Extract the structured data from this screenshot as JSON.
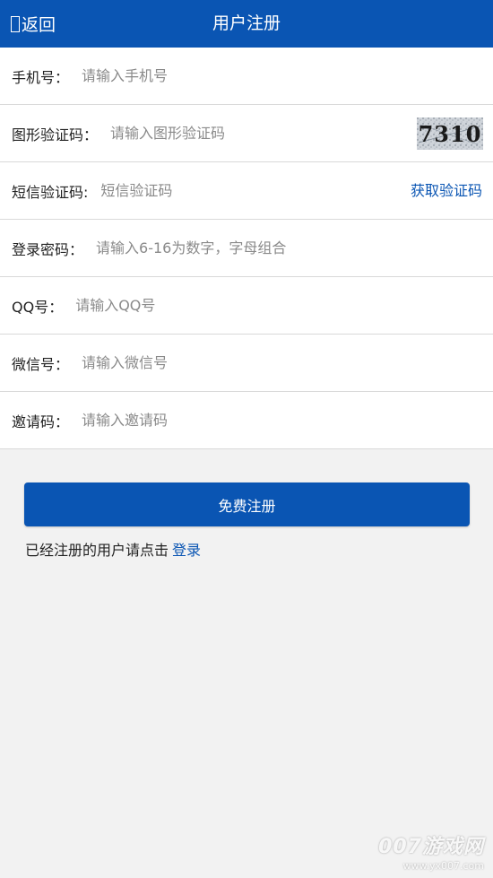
{
  "header": {
    "back_label": "返回",
    "title": "用户注册"
  },
  "form": {
    "phone": {
      "label": "手机号：",
      "placeholder": "请输入手机号"
    },
    "image_code": {
      "label": "图形验证码：",
      "placeholder": "请输入图形验证码",
      "captcha_text": "7310"
    },
    "sms_code": {
      "label": "短信验证码:",
      "placeholder": "短信验证码",
      "get_code_label": "获取验证码"
    },
    "password": {
      "label": "登录密码：",
      "placeholder": "请输入6-16为数字，字母组合"
    },
    "qq": {
      "label": "QQ号：",
      "placeholder": "请输入QQ号"
    },
    "wechat": {
      "label": "微信号：",
      "placeholder": "请输入微信号"
    },
    "invite": {
      "label": "邀请码：",
      "placeholder": "请输入邀请码"
    }
  },
  "actions": {
    "register_label": "免费注册",
    "login_hint": "已经注册的用户请点击",
    "login_link": "登录"
  },
  "watermark": {
    "main": "007游戏网",
    "sub": "www.yx007.com"
  },
  "colors": {
    "primary": "#0a55b3",
    "background": "#f2f2f2",
    "divider": "#d9d9d9"
  }
}
